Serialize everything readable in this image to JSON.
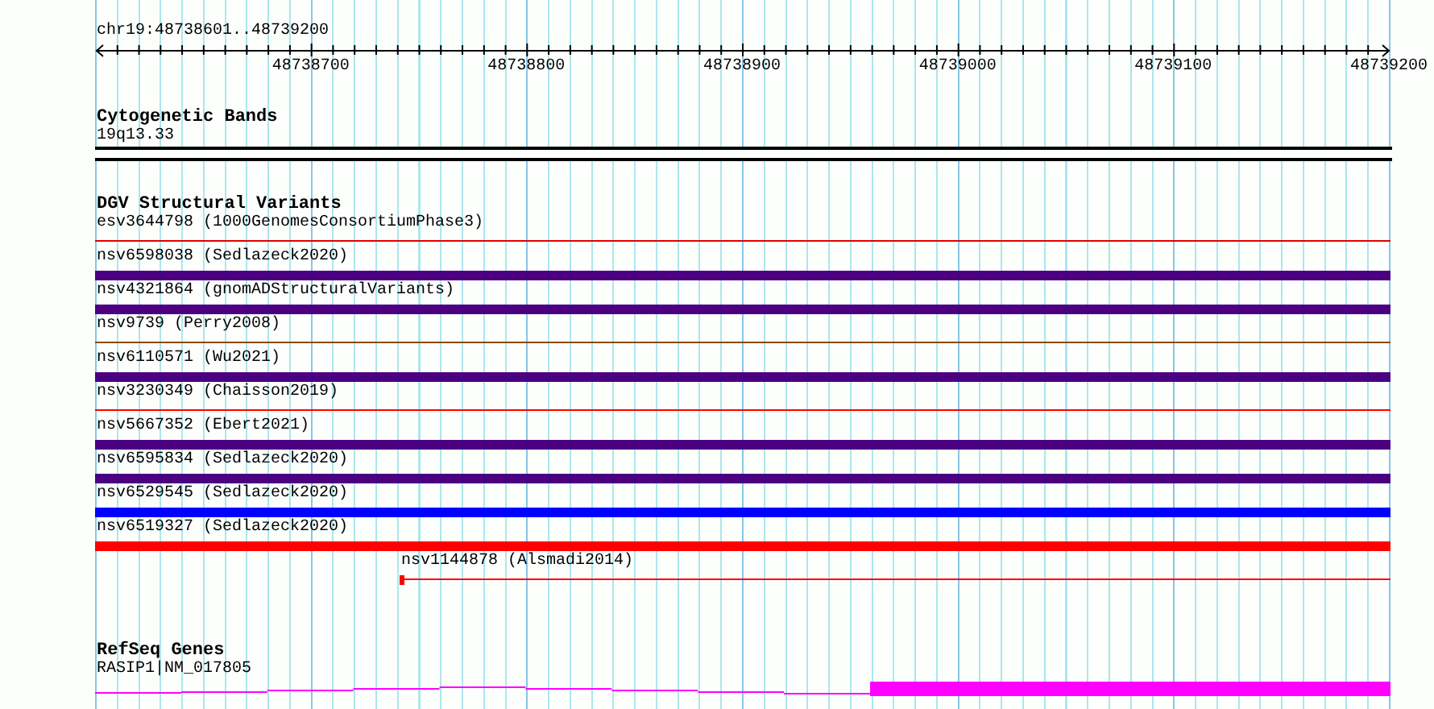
{
  "ruler": {
    "range_label": "chr19:48738601..48739200",
    "ticks": [
      "48738700",
      "48738800",
      "48738900",
      "48739000",
      "48739100",
      "48739200"
    ]
  },
  "cytoband_track": {
    "title": "Cytogenetic Bands",
    "band": "19q13.33"
  },
  "variant_track": {
    "title": "DGV Structural Variants",
    "features": [
      {
        "label": "esv3644798 (1000GenomesConsortiumPhase3)",
        "kind": "thin",
        "color": "#e00000",
        "starts_in_view": false
      },
      {
        "label": "nsv6598038 (Sedlazeck2020)",
        "kind": "thick",
        "color": "#4b0082",
        "starts_in_view": false
      },
      {
        "label": "nsv4321864 (gnomADStructuralVariants)",
        "kind": "thick",
        "color": "#4b0082",
        "starts_in_view": false
      },
      {
        "label": "nsv9739 (Perry2008)",
        "kind": "thin",
        "color": "#8b4a10",
        "starts_in_view": false
      },
      {
        "label": "nsv6110571 (Wu2021)",
        "kind": "thick",
        "color": "#4b0082",
        "starts_in_view": false
      },
      {
        "label": "nsv3230349 (Chaisson2019)",
        "kind": "thin",
        "color": "#ff0000",
        "starts_in_view": false
      },
      {
        "label": "nsv5667352 (Ebert2021)",
        "kind": "thick",
        "color": "#4b0082",
        "starts_in_view": false
      },
      {
        "label": "nsv6595834 (Sedlazeck2020)",
        "kind": "thick",
        "color": "#4b0082",
        "starts_in_view": false
      },
      {
        "label": "nsv6529545 (Sedlazeck2020)",
        "kind": "thick",
        "color": "#0000ff",
        "starts_in_view": false
      },
      {
        "label": "nsv6519327 (Sedlazeck2020)",
        "kind": "thick",
        "color": "#ff0000",
        "starts_in_view": false
      },
      {
        "label": "nsv1144878 (Alsmadi2014)",
        "kind": "thin",
        "color": "#ff0000",
        "starts_in_view": true
      }
    ]
  },
  "gene_track": {
    "title": "RefSeq Genes",
    "transcript": "RASIP1|NM_017805"
  }
}
